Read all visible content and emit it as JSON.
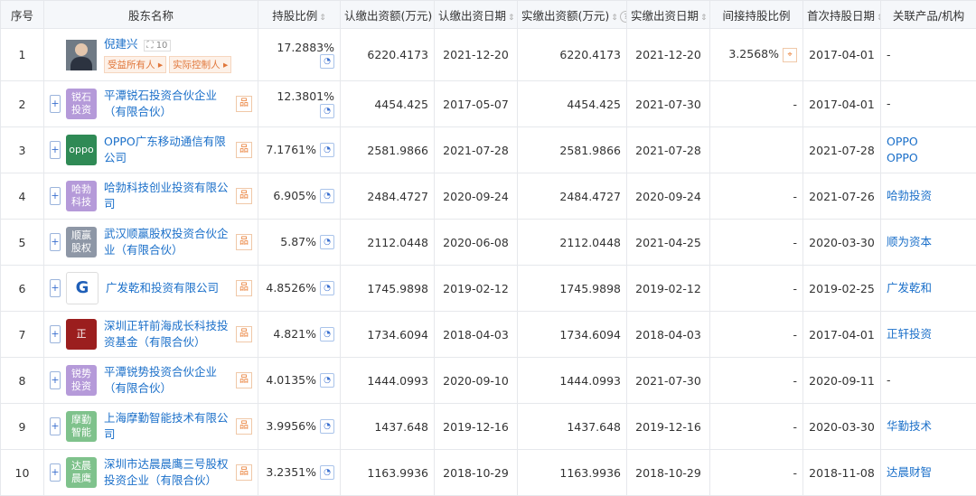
{
  "headers": [
    "序号",
    "股东名称",
    "持股比例",
    "认缴出资额(万元)",
    "认缴出资日期",
    "实缴出资额(万元)",
    "实缴出资日期",
    "间接持股比例",
    "首次持股日期",
    "关联产品/机构"
  ],
  "rows": [
    {
      "idx": "1",
      "name": "倪建兴",
      "count": "10",
      "tags": [
        "受益所有人",
        "实际控制人"
      ],
      "ratio": "17.2883%",
      "sub_amt": "6220.4173",
      "sub_date": "2021-12-20",
      "paid_amt": "6220.4173",
      "paid_date": "2021-12-20",
      "indirect": "3.2568%",
      "first_date": "2017-04-01",
      "product": "-",
      "avatar": true
    },
    {
      "idx": "2",
      "name": "平潭锐石投资合伙企业（有限合伙）",
      "logo_text": "锐石\n投资",
      "logo_color": "#b59ad9",
      "ratio": "12.3801%",
      "sub_amt": "4454.425",
      "sub_date": "2017-05-07",
      "paid_amt": "4454.425",
      "paid_date": "2021-07-30",
      "indirect": "-",
      "first_date": "2017-04-01",
      "product": "-"
    },
    {
      "idx": "3",
      "name": "OPPO广东移动通信有限公司",
      "logo_text": "oppo",
      "logo_color": "#2f8a55",
      "ratio": "7.1761%",
      "sub_amt": "2581.9866",
      "sub_date": "2021-07-28",
      "paid_amt": "2581.9866",
      "paid_date": "2021-07-28",
      "indirect": "",
      "first_date": "2021-07-28",
      "product": "OPPO\nOPPO"
    },
    {
      "idx": "4",
      "name": "哈勃科技创业投资有限公司",
      "logo_text": "哈勃\n科技",
      "logo_color": "#b59ad9",
      "ratio": "6.905%",
      "sub_amt": "2484.4727",
      "sub_date": "2020-09-24",
      "paid_amt": "2484.4727",
      "paid_date": "2020-09-24",
      "indirect": "-",
      "first_date": "2021-07-26",
      "product": "哈勃投资"
    },
    {
      "idx": "5",
      "name": "武汉顺赢股权投资合伙企业（有限合伙）",
      "logo_text": "顺赢\n股权",
      "logo_color": "#8e97a6",
      "ratio": "5.87%",
      "sub_amt": "2112.0448",
      "sub_date": "2020-06-08",
      "paid_amt": "2112.0448",
      "paid_date": "2021-04-25",
      "indirect": "-",
      "first_date": "2020-03-30",
      "product": "顺为资本"
    },
    {
      "idx": "6",
      "name": "广发乾和投资有限公司",
      "logo_text": "G",
      "logo_color": "#ffffff",
      "ratio": "4.8526%",
      "sub_amt": "1745.9898",
      "sub_date": "2019-02-12",
      "paid_amt": "1745.9898",
      "paid_date": "2019-02-12",
      "indirect": "-",
      "first_date": "2019-02-25",
      "product": "广发乾和"
    },
    {
      "idx": "7",
      "name": "深圳正轩前海成长科技投资基金（有限合伙）",
      "logo_text": "正",
      "logo_color": "#9b1e1e",
      "ratio": "4.821%",
      "sub_amt": "1734.6094",
      "sub_date": "2018-04-03",
      "paid_amt": "1734.6094",
      "paid_date": "2018-04-03",
      "indirect": "-",
      "first_date": "2017-04-01",
      "product": "正轩投资"
    },
    {
      "idx": "8",
      "name": "平潭锐势投资合伙企业（有限合伙）",
      "logo_text": "锐势\n投资",
      "logo_color": "#b59ad9",
      "ratio": "4.0135%",
      "sub_amt": "1444.0993",
      "sub_date": "2020-09-10",
      "paid_amt": "1444.0993",
      "paid_date": "2021-07-30",
      "indirect": "-",
      "first_date": "2020-09-11",
      "product": "-"
    },
    {
      "idx": "9",
      "name": "上海摩勤智能技术有限公司",
      "logo_text": "摩勤\n智能",
      "logo_color": "#7fc28c",
      "ratio": "3.9956%",
      "sub_amt": "1437.648",
      "sub_date": "2019-12-16",
      "paid_amt": "1437.648",
      "paid_date": "2019-12-16",
      "indirect": "-",
      "first_date": "2020-03-30",
      "product": "华勤技术"
    },
    {
      "idx": "10",
      "name": "深圳市达晨晨鹰三号股权投资企业（有限合伙）",
      "logo_text": "达晨\n晨鹰",
      "logo_color": "#7fc28c",
      "ratio": "3.2351%",
      "sub_amt": "1163.9936",
      "sub_date": "2018-10-29",
      "paid_amt": "1163.9936",
      "paid_date": "2018-10-29",
      "indirect": "-",
      "first_date": "2018-11-08",
      "product": "达晨财智"
    }
  ]
}
